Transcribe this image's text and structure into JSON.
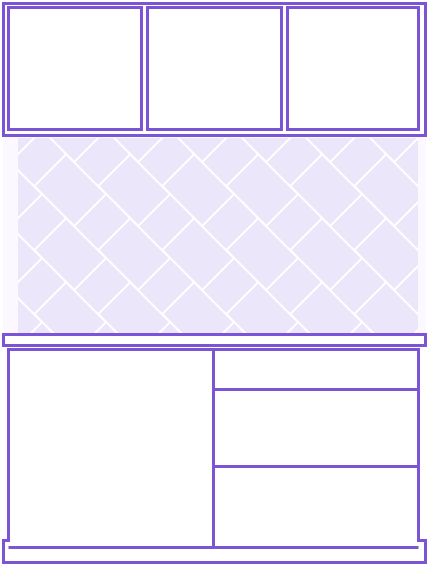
{
  "colors": {
    "stroke": "#7b55d6",
    "tile_fill": "#ebe6fa",
    "grout": "#ffffff",
    "background": "#ffffff",
    "panel_fill": "#ffffff"
  },
  "diagram": {
    "upper_cabinets": {
      "count": 3
    },
    "backsplash": {
      "pattern": "herringbone"
    },
    "base_cabinets": {
      "drawer_count": 3
    }
  }
}
